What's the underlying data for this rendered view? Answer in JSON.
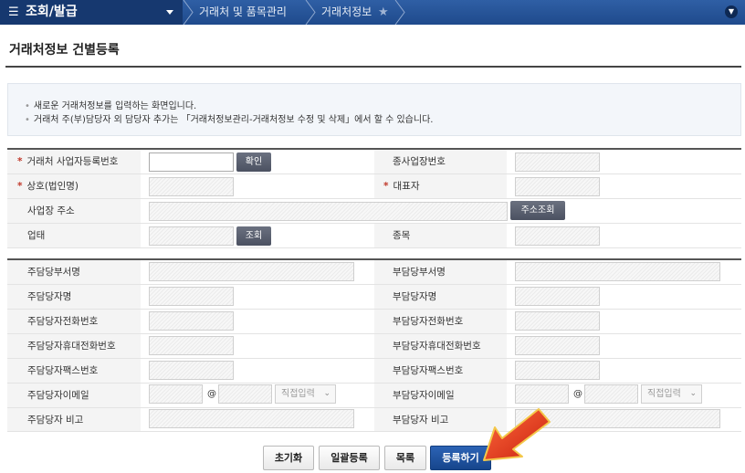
{
  "nav": {
    "menu_title": "조회/발급",
    "breadcrumb": [
      "거래처 및 품목관리",
      "거래처정보"
    ]
  },
  "page": {
    "title": "거래처정보 건별등록"
  },
  "info": [
    "새로운 거래처정보를 입력하는 화면입니다.",
    "거래처 주(부)담당자 외 담당자 추가는 「거래처정보관리-거래처정보 수정 및 삭제」에서 할 수 있습니다."
  ],
  "business_form": {
    "reg_no_label": "거래처 사업자등록번호",
    "confirm_button": "확인",
    "sub_biz_label": "종사업장번호",
    "company_name_label": "상호(법인명)",
    "ceo_label": "대표자",
    "address_label": "사업장 주소",
    "address_search_button": "주소조회",
    "business_type_label": "업태",
    "lookup_button": "조회",
    "item_label": "종목"
  },
  "contact_form": {
    "primary_dept_label": "주담당부서명",
    "secondary_dept_label": "부담당부서명",
    "primary_name_label": "주담당자명",
    "secondary_name_label": "부담당자명",
    "primary_phone_label": "주담당자전화번호",
    "secondary_phone_label": "부담당자전화번호",
    "primary_mobile_label": "주담당자휴대전화번호",
    "secondary_mobile_label": "부담당자휴대전화번호",
    "primary_fax_label": "주담당자팩스번호",
    "secondary_fax_label": "부담당자팩스번호",
    "primary_email_label": "주담당자이메일",
    "secondary_email_label": "부담당자이메일",
    "at_sign": "@",
    "domain_select_value": "직접입력",
    "primary_note_label": "주담당자 비고",
    "secondary_note_label": "부담당자 비고"
  },
  "buttons": {
    "reset": "초기화",
    "bulk_register": "일괄등록",
    "list": "목록",
    "register": "등록하기"
  },
  "colors": {
    "nav_bar": "#1f4a8c",
    "menu_block": "#16386f",
    "primary_button": "#1f54a3",
    "required_mark": "#c0392b",
    "arrow": "#e53a1e"
  }
}
